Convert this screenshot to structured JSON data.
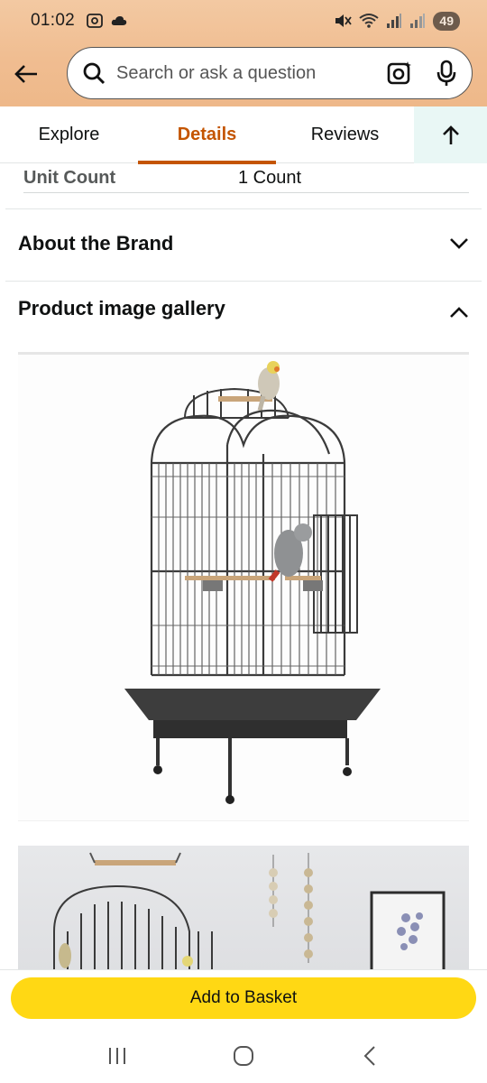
{
  "status_bar": {
    "time": "01:02",
    "battery": "49"
  },
  "search": {
    "placeholder": "Search or ask a question"
  },
  "tabs": [
    {
      "label": "Explore"
    },
    {
      "label": "Details",
      "active": true
    },
    {
      "label": "Reviews"
    }
  ],
  "details": {
    "unit_count_label": "Unit Count",
    "unit_count_value": "1 Count"
  },
  "sections": {
    "about_brand": "About the Brand",
    "gallery": "Product image gallery"
  },
  "actions": {
    "add_to_basket": "Add to Basket"
  },
  "icons": {
    "back": "arrow-left-icon",
    "search": "search-icon",
    "camera": "camera-search-icon",
    "mic": "microphone-icon",
    "scroll_top": "arrow-up-icon",
    "about_toggle": "chevron-down-icon",
    "gallery_toggle": "chevron-up-icon"
  },
  "colors": {
    "header_bg": "#f0bd91",
    "active_tab": "#c45500",
    "add_button": "#ffd814",
    "top_button_bg": "#e9f7f5"
  }
}
